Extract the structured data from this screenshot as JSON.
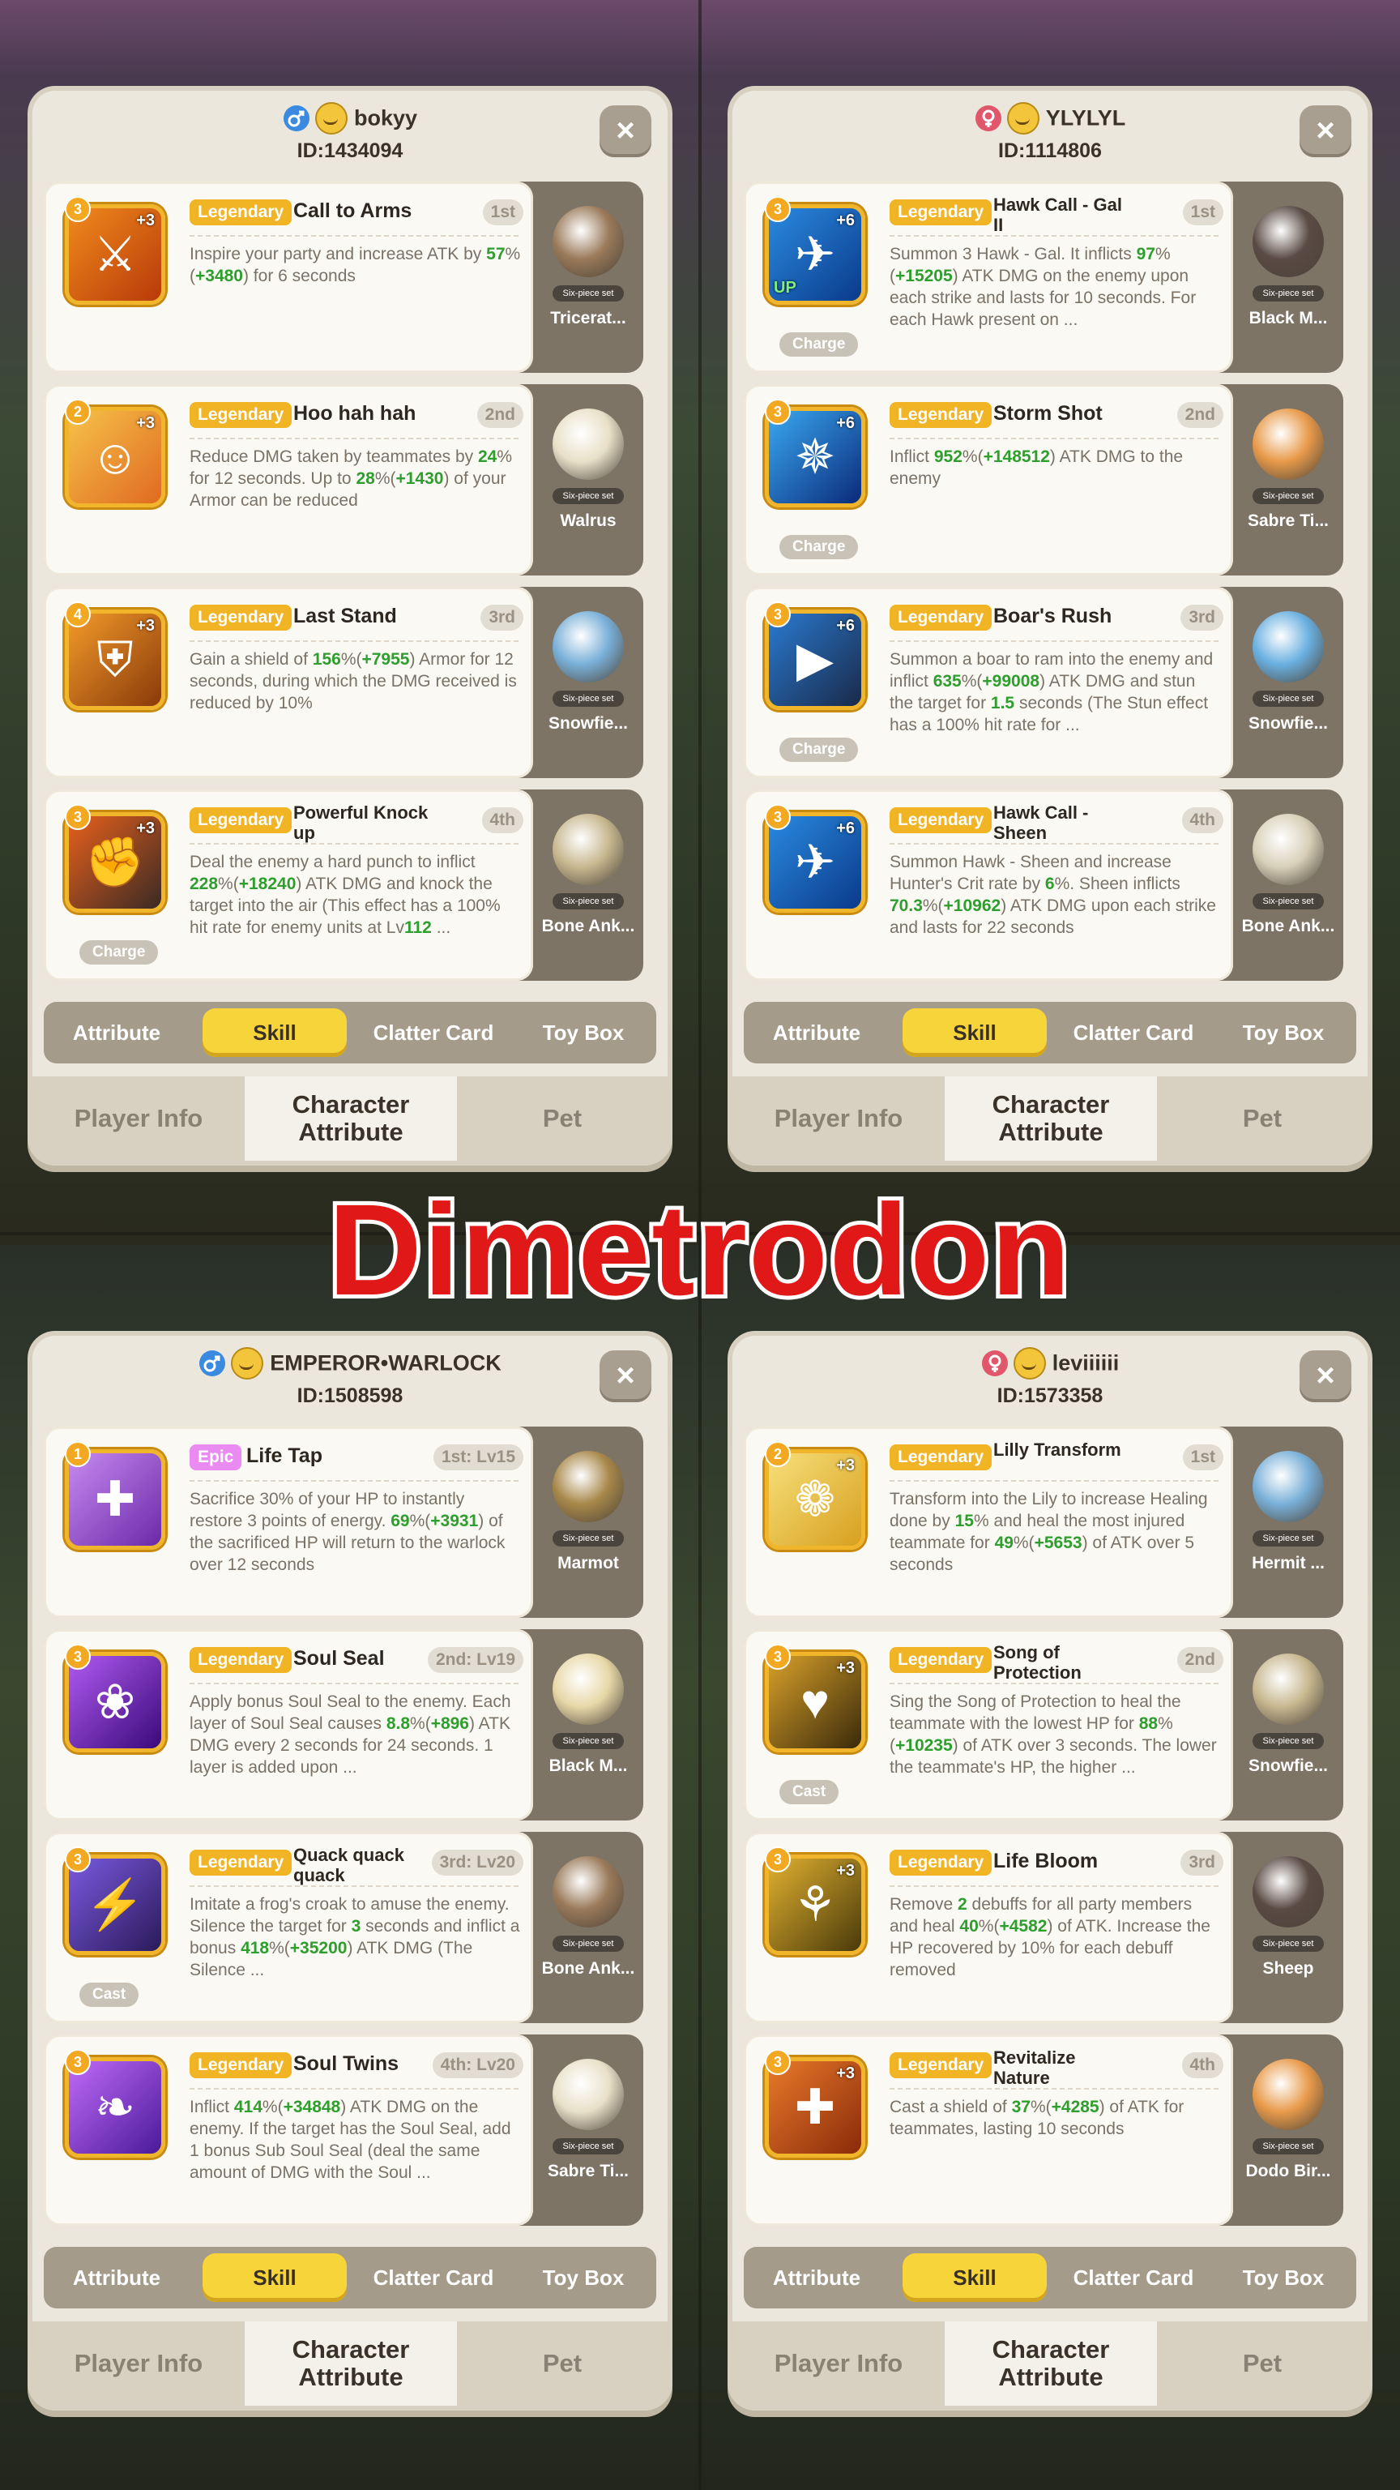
{
  "overlay_title": "Dimetrodon",
  "colors": {
    "legendary": "#f0b424",
    "epic": "#e98bf1",
    "green_value": "#2e9e2e",
    "tab_active": "#f7d43a",
    "overlay_text": "#e01818"
  },
  "tabs": [
    "Attribute",
    "Skill",
    "Clatter Card",
    "Toy Box"
  ],
  "bottom_tabs": [
    "Player Info",
    "Character Attribute",
    "Pet"
  ],
  "players": [
    {
      "name": "bokyy",
      "gender": "male",
      "id": "ID:1434094",
      "skills": [
        {
          "level": "3",
          "plus": "+3",
          "up": "",
          "tag": "",
          "rarity": "Legendary",
          "name": "Call to Arms",
          "order": "1st",
          "icon": "warrior-icon",
          "desc": "Inspire your party and increase ATK by <g>57</g>%(<g>+3480</g>) for 6 seconds",
          "pet": "Tricerat...",
          "pet_badge": "Six-piece set"
        },
        {
          "level": "2",
          "plus": "+3",
          "up": "",
          "tag": "",
          "rarity": "Legendary",
          "name": "Hoo hah hah",
          "order": "2nd",
          "icon": "shout-icon",
          "desc": "Reduce DMG taken by teammates by <g>24</g>% for 12 seconds. Up to <g>28</g>%(<g>+1430</g>) of your Armor can be reduced",
          "pet": "Walrus",
          "pet_badge": "Six-piece set"
        },
        {
          "level": "4",
          "plus": "+3",
          "up": "",
          "tag": "",
          "rarity": "Legendary",
          "name": "Last Stand",
          "order": "3rd",
          "icon": "shield-icon",
          "desc": "Gain a shield of <g>156</g>%(<g>+7955</g>) Armor for 12 seconds, during which the DMG received is reduced by 10%",
          "pet": "Snowfie...",
          "pet_badge": "Six-piece set"
        },
        {
          "level": "3",
          "plus": "+3",
          "up": "",
          "tag": "Charge",
          "rarity": "Legendary",
          "name": "Powerful Knock up",
          "order": "4th",
          "icon": "punch-icon",
          "desc": "Deal the enemy a hard punch to inflict <g>228</g>%(<g>+18240</g>) ATK DMG and knock the target into the air (This effect has a 100% hit rate for enemy units at Lv<g>112</g> ...",
          "pet": "Bone Ank...",
          "pet_badge": "Six-piece set"
        }
      ]
    },
    {
      "name": "YLYLYL",
      "gender": "female",
      "id": "ID:1114806",
      "skills": [
        {
          "level": "3",
          "plus": "+6",
          "up": "UP",
          "tag": "Charge",
          "rarity": "Legendary",
          "name": "Hawk Call - Gal II",
          "order": "1st",
          "icon": "hawk-icon",
          "desc": "Summon 3 Hawk - Gal. It inflicts <g>97</g>%(<g>+15205</g>) ATK DMG on the enemy upon each strike and lasts for 10 seconds. For each Hawk present on ...",
          "pet": "Black M...",
          "pet_badge": "Six-piece set"
        },
        {
          "level": "3",
          "plus": "+6",
          "up": "",
          "tag": "Charge",
          "rarity": "Legendary",
          "name": "Storm Shot",
          "order": "2nd",
          "icon": "arrow-burst-icon",
          "desc": "Inflict <g>952</g>%(<g>+148512</g>) ATK DMG to the enemy",
          "pet": "Sabre Ti...",
          "pet_badge": "Six-piece set"
        },
        {
          "level": "3",
          "plus": "+6",
          "up": "",
          "tag": "Charge",
          "rarity": "Legendary",
          "name": "Boar's Rush",
          "order": "3rd",
          "icon": "boar-icon",
          "desc": "Summon a boar to ram into the enemy and inflict <g>635</g>%(<g>+99008</g>) ATK DMG and stun the target for <g>1.5</g> seconds (The Stun effect has a 100% hit rate for ...",
          "pet": "Snowfie...",
          "pet_badge": "Six-piece set"
        },
        {
          "level": "3",
          "plus": "+6",
          "up": "",
          "tag": "",
          "rarity": "Legendary",
          "name": "Hawk Call - Sheen",
          "order": "4th",
          "icon": "hawk-icon",
          "desc": "Summon Hawk - Sheen and increase Hunter's Crit rate by <g>6</g>%. Sheen inflicts <g>70.3</g>%(<g>+10962</g>) ATK DMG upon each strike and lasts for 22 seconds",
          "pet": "Bone Ank...",
          "pet_badge": "Six-piece set"
        }
      ]
    },
    {
      "name": "EMPEROR•WARLOCK",
      "gender": "male",
      "id": "ID:1508598",
      "skills": [
        {
          "level": "1",
          "plus": "",
          "up": "",
          "tag": "",
          "rarity": "Epic",
          "name": "Life Tap",
          "order": "1st: Lv15",
          "icon": "life-tap-icon",
          "desc": "Sacrifice 30% of your HP to instantly restore 3 points of energy. <g>69</g>%(<g>+3931</g>) of the sacrificed HP will return to the warlock over 12 seconds",
          "pet": "Marmot",
          "pet_badge": "Six-piece set"
        },
        {
          "level": "3",
          "plus": "",
          "up": "",
          "tag": "",
          "rarity": "Legendary",
          "name": "Soul Seal",
          "order": "2nd: Lv19",
          "icon": "soul-flame-icon",
          "desc": "Apply bonus Soul Seal to the enemy. Each layer of Soul Seal causes <g>8.8</g>%(<g>+896</g>) ATK DMG every 2 seconds for 24 seconds. 1 layer is added upon ...",
          "pet": "Black M...",
          "pet_badge": "Six-piece set"
        },
        {
          "level": "3",
          "plus": "",
          "up": "",
          "tag": "Cast",
          "rarity": "Legendary",
          "name": "Quack quack quack",
          "order": "3rd: Lv20",
          "icon": "frog-croak-icon",
          "desc": "Imitate a frog's croak to amuse the enemy. Silence the target for <g>3</g> seconds and inflict a bonus <g>418</g>%(<g>+35200</g>) ATK DMG (The Silence ...",
          "pet": "Bone Ank...",
          "pet_badge": "Six-piece set"
        },
        {
          "level": "3",
          "plus": "",
          "up": "",
          "tag": "",
          "rarity": "Legendary",
          "name": "Soul Twins",
          "order": "4th: Lv20",
          "icon": "twin-flame-icon",
          "desc": "Inflict <g>414</g>%(<g>+34848</g>) ATK DMG on the enemy. If the target has the Soul Seal, add 1 bonus Sub Soul Seal (deal the same amount of DMG with the Soul ...",
          "pet": "Sabre Ti...",
          "pet_badge": "Six-piece set"
        }
      ]
    },
    {
      "name": "leviiiiii",
      "gender": "female",
      "id": "ID:1573358",
      "skills": [
        {
          "level": "2",
          "plus": "+3",
          "up": "",
          "tag": "",
          "rarity": "Legendary",
          "name": "Lilly Transform",
          "order": "1st",
          "icon": "owl-icon",
          "desc": "Transform into the Lily to increase Healing done by <g>15</g>% and heal the most injured teammate for <g>49</g>%(<g>+5653</g>) of ATK over 5 seconds",
          "pet": "Hermit ...",
          "pet_badge": "Six-piece set"
        },
        {
          "level": "3",
          "plus": "+3",
          "up": "",
          "tag": "Cast",
          "rarity": "Legendary",
          "name": "Song of Protection",
          "order": "2nd",
          "icon": "heart-song-icon",
          "desc": "Sing the Song of Protection to heal the teammate with the lowest HP for <g>88</g>%(<g>+10235</g>) of ATK over 3 seconds. The lower the teammate's HP, the higher ...",
          "pet": "Snowfie...",
          "pet_badge": "Six-piece set"
        },
        {
          "level": "3",
          "plus": "+3",
          "up": "",
          "tag": "",
          "rarity": "Legendary",
          "name": "Life Bloom",
          "order": "3rd",
          "icon": "bloom-icon",
          "desc": "Remove <g>2</g> debuffs for all party members and heal <g>40</g>%(<g>+4582</g>) of ATK. Increase the HP recovered by 10% for each debuff removed",
          "pet": "Sheep",
          "pet_badge": "Six-piece set"
        },
        {
          "level": "3",
          "plus": "+3",
          "up": "",
          "tag": "",
          "rarity": "Legendary",
          "name": "Revitalize Nature",
          "order": "4th",
          "icon": "nature-cross-icon",
          "desc": "Cast a shield of <g>37</g>%(<g>+4285</g>) of ATK for teammates, lasting 10 seconds",
          "pet": "Dodo Bir...",
          "pet_badge": "Six-piece set"
        }
      ]
    }
  ]
}
